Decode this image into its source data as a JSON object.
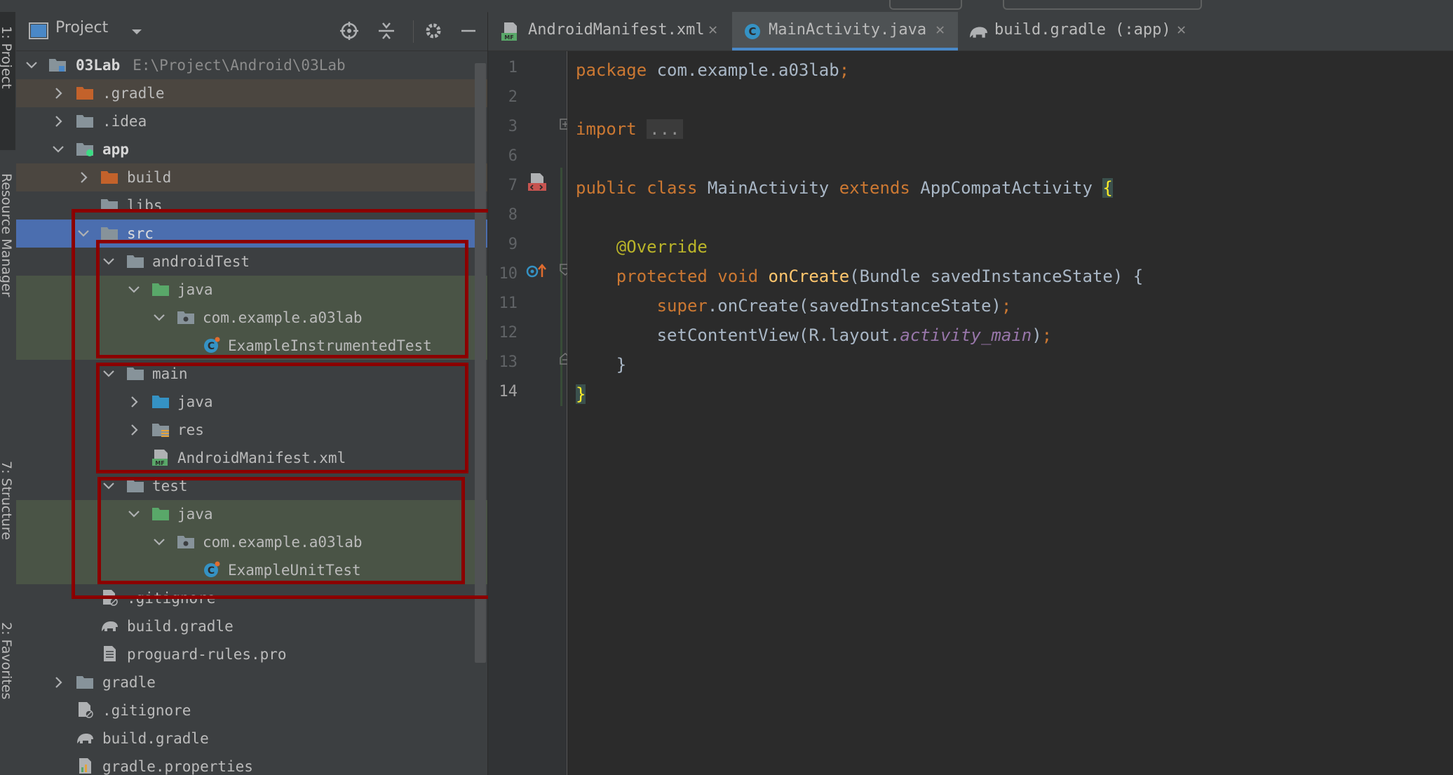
{
  "project_panel": {
    "title": "Project",
    "tree": [
      {
        "label": "03Lab",
        "path": "E:\\Project\\Android\\03Lab"
      },
      {
        "label": ".gradle"
      },
      {
        "label": ".idea"
      },
      {
        "label": "app"
      },
      {
        "label": "build"
      },
      {
        "label": "libs"
      },
      {
        "label": "src"
      },
      {
        "label": "androidTest"
      },
      {
        "label": "java"
      },
      {
        "label": "com.example.a03lab"
      },
      {
        "label": "ExampleInstrumentedTest"
      },
      {
        "label": "main"
      },
      {
        "label": "java"
      },
      {
        "label": "res"
      },
      {
        "label": "AndroidManifest.xml"
      },
      {
        "label": "test"
      },
      {
        "label": "java"
      },
      {
        "label": "com.example.a03lab"
      },
      {
        "label": "ExampleUnitTest"
      },
      {
        "label": ".gitignore"
      },
      {
        "label": "build.gradle"
      },
      {
        "label": "proguard-rules.pro"
      },
      {
        "label": "gradle"
      },
      {
        "label": ".gitignore"
      },
      {
        "label": "build.gradle"
      },
      {
        "label": "gradle.properties"
      }
    ]
  },
  "tool_stripe": {
    "project": "1: Project",
    "resource_manager": "Resource Manager",
    "structure": "7: Structure",
    "favorites": "2: Favorites"
  },
  "tabs": [
    {
      "label": "AndroidManifest.xml",
      "badge": "MF"
    },
    {
      "label": "MainActivity.java",
      "badge": "C"
    },
    {
      "label": "build.gradle (:app)"
    }
  ],
  "editor": {
    "line_numbers": [
      "1",
      "2",
      "3",
      "6",
      "7",
      "8",
      "9",
      "10",
      "11",
      "12",
      "13",
      "14"
    ],
    "code": {
      "package_kw": "package",
      "package_name": " com.example.a03lab",
      "semi": ";",
      "import_kw": "import",
      "import_fold": "...",
      "public_kw": "public",
      "class_kw": "class",
      "class_name": " MainActivity ",
      "extends_kw": "extends",
      "super_class": " AppCompatActivity ",
      "open_brace": "{",
      "annotation": "@Override",
      "protected_kw": "protected",
      "void_kw": "void",
      "method_name": "onCreate",
      "params": "(Bundle savedInstanceState) {",
      "super_kw": "super",
      "super_call": ".onCreate(savedInstanceState)",
      "set_content": "setContentView(R.layout.",
      "layout_name": "activity_main",
      "set_content_end": ")",
      "close_method": "}",
      "close_class": "}"
    }
  },
  "colors": {
    "keyword": "#cc7832",
    "annotation": "#bbb529",
    "method": "#ffc66d",
    "field": "#9876aa",
    "highlight_box": "#8b0000",
    "selection": "#4b6eaf"
  }
}
